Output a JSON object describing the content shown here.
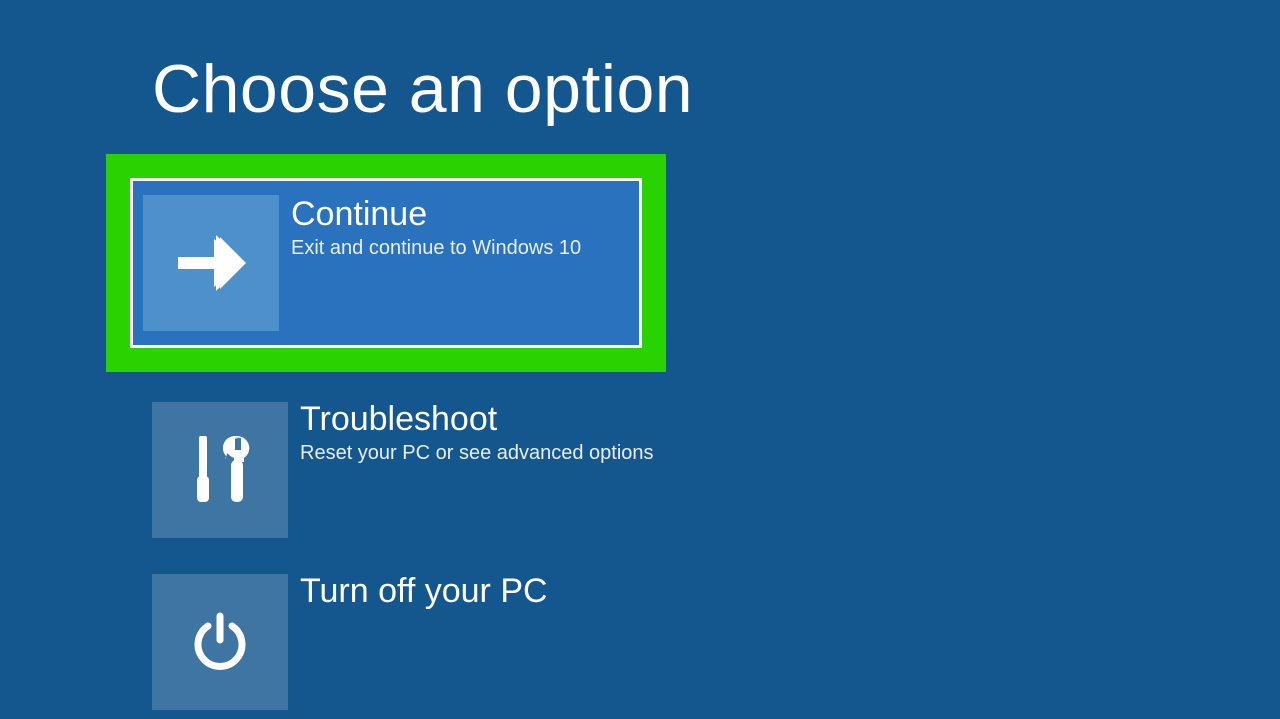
{
  "page": {
    "title": "Choose an option"
  },
  "options": {
    "continue": {
      "title": "Continue",
      "description": "Exit and continue to Windows 10",
      "icon": "arrow-right-icon",
      "highlighted": true
    },
    "troubleshoot": {
      "title": "Troubleshoot",
      "description": "Reset your PC or see advanced options",
      "icon": "tools-icon"
    },
    "turnoff": {
      "title": "Turn off your PC",
      "description": "",
      "icon": "power-icon"
    }
  },
  "colors": {
    "background": "#14578e",
    "highlight_border": "#29d300",
    "tile_selected_bg": "#2a72bd",
    "tile_selected_icon_bg": "#4e91ca",
    "tile_unselected_icon_bg": "rgba(255,255,255,0.18)"
  }
}
